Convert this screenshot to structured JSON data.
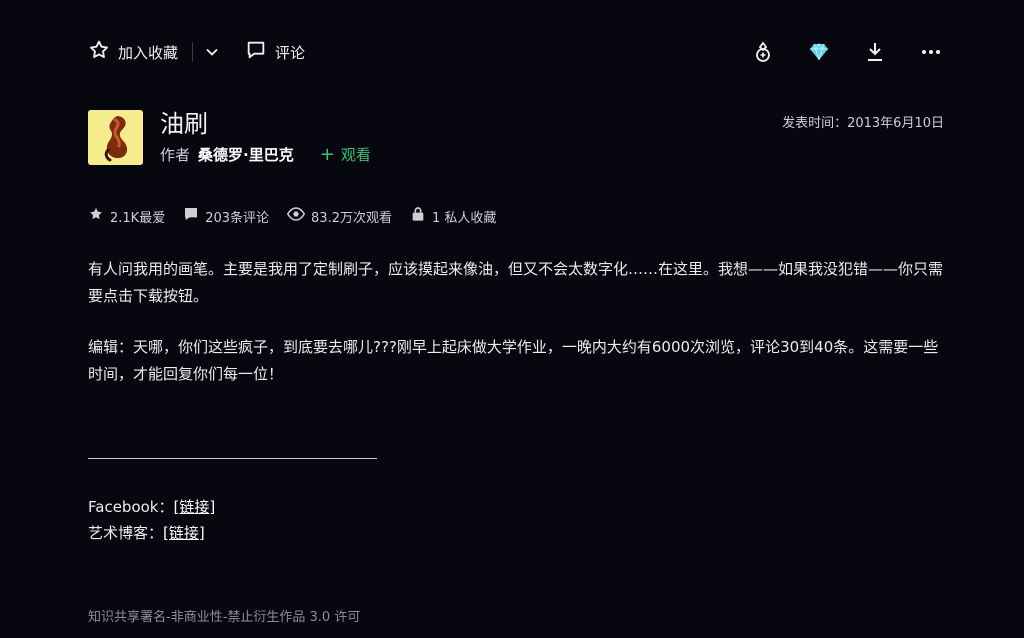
{
  "toolbar": {
    "favorite_label": "加入收藏",
    "comment_label": "评论",
    "icons": [
      "star-outline-icon",
      "chevron-down-icon",
      "comment-icon",
      "gift-icon",
      "gem-icon",
      "download-icon",
      "more-icon"
    ],
    "gem_color": "#5fd3ea"
  },
  "deviation": {
    "title": "油刷",
    "author_prefix": "作者",
    "author": "桑德罗·里巴克",
    "watch_label": "观看",
    "published": "发表时间：2013年6月10日",
    "watch_color": "#3ec276"
  },
  "stats": {
    "favorites": "2.1K最爱",
    "comments": "203条评论",
    "views": "83.2万次观看",
    "private_collections": "1 私人收藏"
  },
  "description": {
    "p1": "有人问我用的画笔。主要是我用了定制刷子，应该摸起来像油，但又不会太数字化……在这里。我想——如果我没犯错——你只需要点击下载按钮。",
    "p2": "编辑：天哪，你们这些疯子，到底要去哪儿???刚早上起床做大学作业，一晚内大约有6000次浏览，评论30到40条。这需要一些时间，才能回复你们每一位！"
  },
  "links": {
    "facebook_label": "Facebook：",
    "facebook_link": "[链接]",
    "blog_label": "艺术博客：",
    "blog_link": "[链接]"
  },
  "license": "知识共享署名-非商业性-禁止衍生作品 3.0 许可"
}
